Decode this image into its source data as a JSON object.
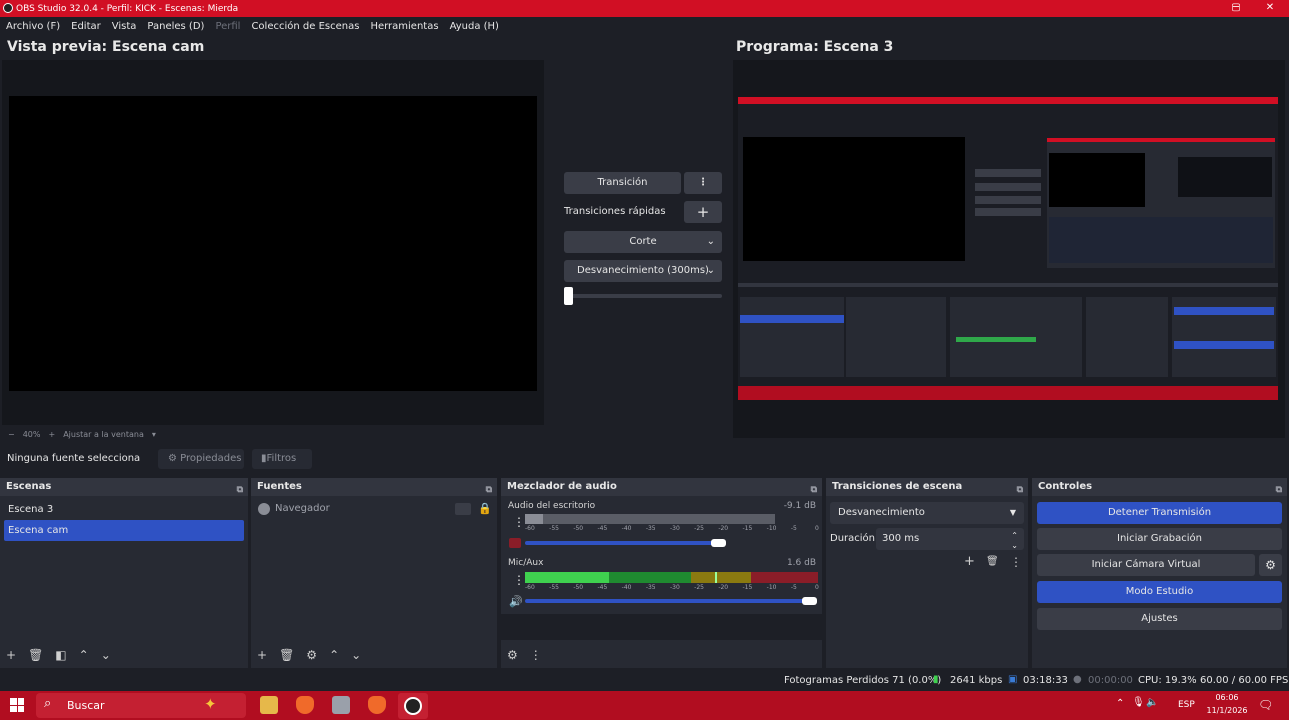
{
  "window": {
    "title": "OBS Studio 32.0.4 - Perfil: KICK - Escenas: Mierda",
    "controls": [
      "─",
      "▢",
      "✕"
    ]
  },
  "menu": [
    {
      "label": "Archivo (F)",
      "enabled": true
    },
    {
      "label": "Editar",
      "enabled": true
    },
    {
      "label": "Vista",
      "enabled": true
    },
    {
      "label": "Paneles (D)",
      "enabled": true
    },
    {
      "label": "Perfil",
      "enabled": false
    },
    {
      "label": "Colección de Escenas",
      "enabled": true
    },
    {
      "label": "Herramientas",
      "enabled": true
    },
    {
      "label": "Ayuda (H)",
      "enabled": true
    }
  ],
  "preview": {
    "title": "Vista previa: Escena cam",
    "zoom": "40%",
    "fit_label": "Ajustar a la ventana",
    "zoom_minus": "−",
    "zoom_plus": "+"
  },
  "program": {
    "title": "Programa: Escena 3"
  },
  "transition_panel": {
    "transition_button": "Transición",
    "quick_label": "Transiciones rápidas",
    "quick_items": [
      "Corte",
      "Desvanecimiento (300ms)"
    ],
    "tbar_level": 0
  },
  "source_toolbar": {
    "no_source": "Ninguna fuente selecciona",
    "properties": "Propiedades",
    "filters": "Filtros"
  },
  "scenes": {
    "title": "Escenas",
    "items": [
      {
        "label": "Escena 3",
        "selected": false
      },
      {
        "label": "Escena cam",
        "selected": true
      }
    ]
  },
  "sources": {
    "title": "Fuentes",
    "items": [
      {
        "label": "Navegador"
      }
    ]
  },
  "mixer": {
    "title": "Mezclador de audio",
    "channels": [
      {
        "name": "Audio del escritorio",
        "db": "-9.1 dB",
        "muted": true,
        "volume": 0.98
      },
      {
        "name": "Mic/Aux",
        "db": "1.6 dB",
        "muted": false,
        "volume": 1.0
      }
    ],
    "scale": [
      "-60",
      "-55",
      "-50",
      "-45",
      "-40",
      "-35",
      "-30",
      "-25",
      "-20",
      "-15",
      "-10",
      "-5",
      "0"
    ]
  },
  "scene_transitions": {
    "title": "Transiciones de escena",
    "selected": "Desvanecimiento",
    "duration_label": "Duración",
    "duration_value": "300 ms"
  },
  "controls": {
    "title": "Controles",
    "buttons": [
      {
        "label": "Detener Transmisión",
        "active": true
      },
      {
        "label": "Iniciar Grabación",
        "active": false
      },
      {
        "label": "Iniciar Cámara Virtual",
        "active": false
      },
      {
        "label": "Modo Estudio",
        "active": true
      },
      {
        "label": "Ajustes",
        "active": false
      }
    ]
  },
  "status": {
    "dropped": "Fotogramas Perdidos 71 (0.0%)",
    "bitrate": "2641 kbps",
    "stream_time": "03:18:33",
    "rec_time": "00:00:00",
    "cpu": "CPU: 19.3%",
    "fps": "60.00 / 60.00 FPS"
  },
  "taskbar": {
    "search_placeholder": "Buscar",
    "lang": "ESP",
    "time": "06:06",
    "date": "11/1/2026"
  },
  "colors": {
    "accent_red": "#d10f24",
    "accent_blue": "#2f52c4",
    "panel": "#272a33",
    "background": "#1d1f26"
  }
}
